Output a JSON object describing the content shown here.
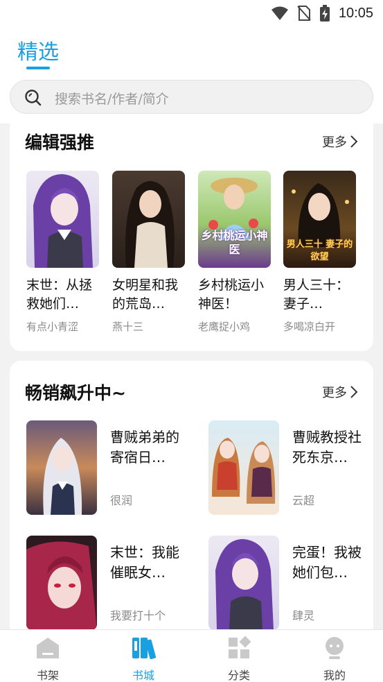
{
  "status_bar": {
    "time": "10:05"
  },
  "header": {
    "tab_selected": "精选"
  },
  "search": {
    "placeholder": "搜索书名/作者/简介"
  },
  "editor_picks": {
    "title": "编辑强推",
    "more_label": "更多",
    "books": [
      {
        "title": "末世：从拯救她们…",
        "author": "有点小青涩"
      },
      {
        "title": "女明星和我的荒岛…",
        "author": "燕十三"
      },
      {
        "title": "乡村桃运小神医！",
        "author": "老鹰捉小鸡",
        "cover_text": "乡村桃运小神医"
      },
      {
        "title": "男人三十：妻子…",
        "author": "多喝凉白开",
        "cover_text": "男人三十 妻子的欲望"
      }
    ]
  },
  "bestsellers": {
    "title": "畅销飙升中~",
    "more_label": "更多",
    "books": [
      {
        "title": "曹贼弟弟的寄宿日…",
        "author": "很润"
      },
      {
        "title": "曹贼教授社死东京…",
        "author": "云超"
      },
      {
        "title": "末世：我能催眠女…",
        "author": "我要打十个"
      },
      {
        "title": "完蛋！我被她们包…",
        "author": "肆灵"
      }
    ]
  },
  "bottom_nav": {
    "items": [
      {
        "label": "书架",
        "icon": "bookshelf-icon"
      },
      {
        "label": "书城",
        "icon": "bookstore-icon",
        "active": true
      },
      {
        "label": "分类",
        "icon": "category-icon"
      },
      {
        "label": "我的",
        "icon": "profile-icon"
      }
    ]
  },
  "colors": {
    "accent": "#1a9fe0",
    "background": "#f2f2f2",
    "muted_text": "#8a8a8a"
  }
}
